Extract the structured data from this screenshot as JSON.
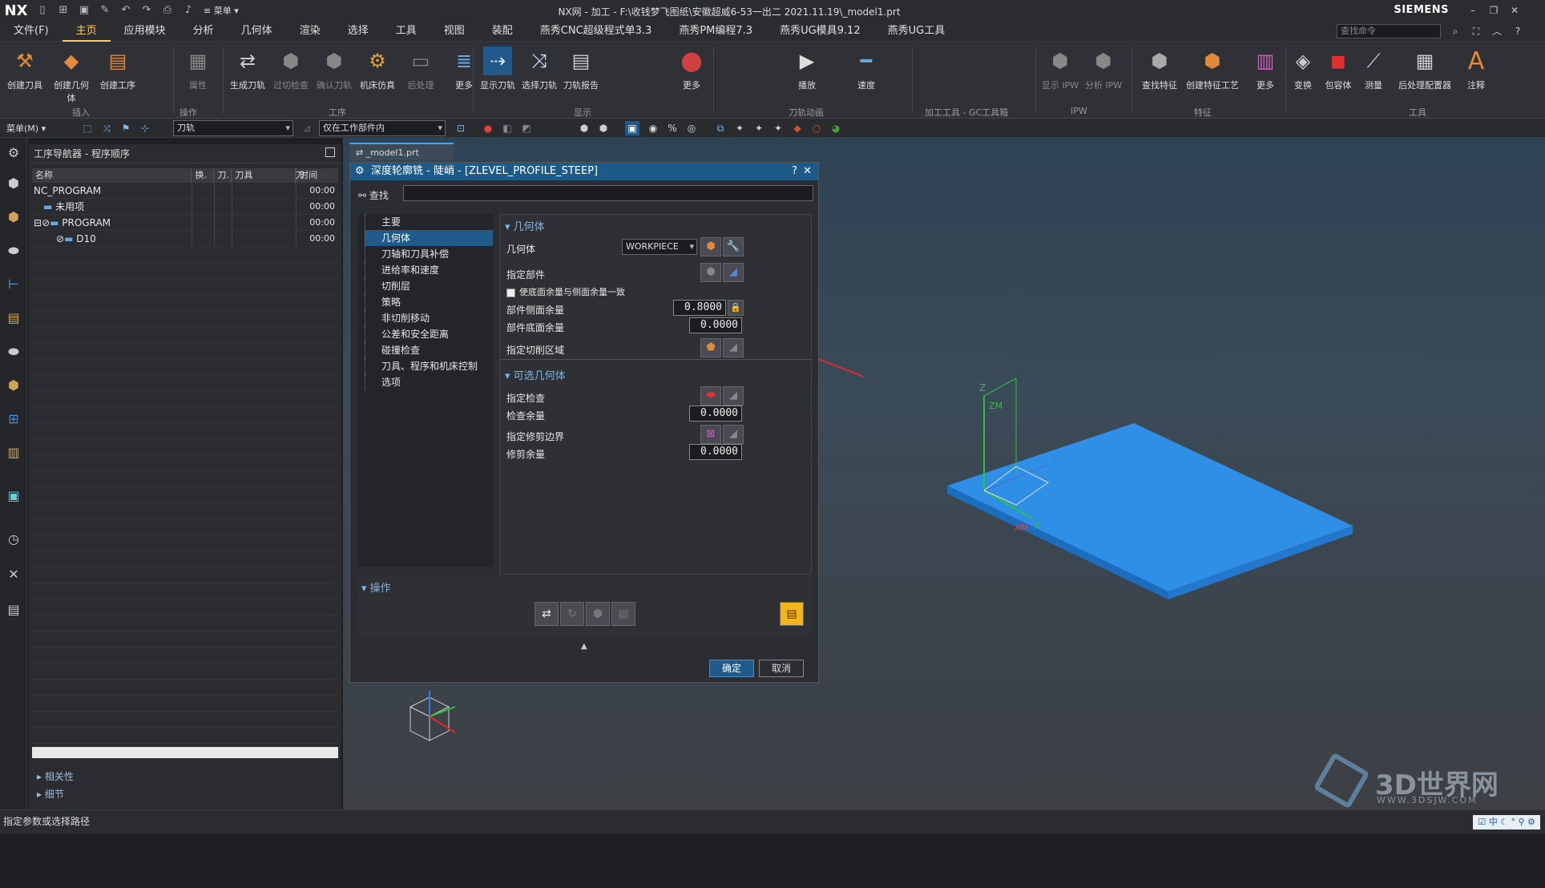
{
  "app": {
    "logo": "NX",
    "title": "NX网 - 加工 - F:\\收钱梦飞图纸\\安徽超威6-53一出二 2021.11.19\\_model1.prt",
    "brand": "SIEMENS",
    "quick_menu": "≡ 菜单 ▾"
  },
  "menubar": {
    "items": [
      "文件(F)",
      "主页",
      "应用模块",
      "分析",
      "几何体",
      "渲染",
      "选择",
      "工具",
      "视图",
      "装配",
      "燕秀CNC超级程式单3.3",
      "燕秀PM编程7.3",
      "燕秀UG模具9.12",
      "燕秀UG工具"
    ],
    "active_index": 1,
    "search_placeholder": "查找命令"
  },
  "ribbon": {
    "buttons": [
      {
        "label": "创建刀具",
        "icon": "create-tool-icon"
      },
      {
        "label": "创建几何体",
        "icon": "create-geometry-icon"
      },
      {
        "label": "创建工序",
        "icon": "create-operation-icon"
      },
      {
        "label": "属性",
        "icon": "properties-icon"
      },
      {
        "label": "生成刀轨",
        "icon": "generate-path-icon"
      },
      {
        "label": "过切检查",
        "icon": "gouge-check-icon"
      },
      {
        "label": "确认刀轨",
        "icon": "verify-path-icon"
      },
      {
        "label": "机床仿真",
        "icon": "machine-sim-icon"
      },
      {
        "label": "后处理",
        "icon": "postprocess-icon"
      },
      {
        "label": "更多",
        "icon": "more-icon"
      },
      {
        "label": "显示刀轨",
        "icon": "show-path-icon"
      },
      {
        "label": "选择刀轨",
        "icon": "select-path-icon"
      },
      {
        "label": "刀轨报告",
        "icon": "path-report-icon"
      },
      {
        "label": "更多",
        "icon": "more-icon"
      },
      {
        "label": "播放",
        "icon": "play-icon"
      },
      {
        "label": "速度",
        "icon": "speed-icon"
      },
      {
        "label": "显示 IPW",
        "icon": "show-ipw-icon"
      },
      {
        "label": "分析 IPW",
        "icon": "analyze-ipw-icon"
      },
      {
        "label": "查找特征",
        "icon": "find-feature-icon"
      },
      {
        "label": "创建特征工艺",
        "icon": "feature-process-icon"
      },
      {
        "label": "更多",
        "icon": "more-icon"
      },
      {
        "label": "变换",
        "icon": "transform-icon"
      },
      {
        "label": "包容体",
        "icon": "bounding-body-icon"
      },
      {
        "label": "测量",
        "icon": "measure-icon"
      },
      {
        "label": "后处理配置器",
        "icon": "post-config-icon"
      },
      {
        "label": "注释",
        "icon": "annotation-icon"
      }
    ],
    "groups": [
      "插入",
      "操作",
      "工序",
      "显示",
      "刀轨动画",
      "加工工具 - GC工具箱",
      "IPW",
      "特征",
      "工具"
    ]
  },
  "selbar": {
    "menu": "菜单(M) ▾",
    "filter1": "刀轨",
    "filter2": "仅在工作部件内"
  },
  "navigator": {
    "title": "工序导航器 - 程序顺序",
    "columns": [
      "名称",
      "换.",
      "刀.",
      "刀具",
      "刀",
      "时间"
    ],
    "rows": [
      {
        "name": "NC_PROGRAM",
        "time": "00:00",
        "indent": 0
      },
      {
        "name": "未用项",
        "time": "00:00",
        "indent": 1
      },
      {
        "name": "PROGRAM",
        "time": "00:00",
        "indent": 1
      },
      {
        "name": "D10",
        "time": "00:00",
        "indent": 2
      }
    ],
    "sections": [
      "相关性",
      "细节"
    ]
  },
  "viewport_tab": "_model1.prt",
  "dialog": {
    "title": "深度轮廓铣 - 陡峭 - [ZLEVEL_PROFILE_STEEP]",
    "find_label": "查找",
    "tree": [
      "主要",
      "几何体",
      "刀轴和刀具补偿",
      "进给率和速度",
      "切削层",
      "策略",
      "非切削移动",
      "公差和安全距离",
      "碰撞检查",
      "刀具、程序和机床控制",
      "选项"
    ],
    "tree_selected": 1,
    "geometry_section": "几何体",
    "geometry_label": "几何体",
    "geometry_value": "WORKPIECE",
    "specify_part": "指定部件",
    "same_floor_stock": "使底面余量与侧面余量一致",
    "side_stock_label": "部件侧面余量",
    "side_stock_value": "0.8000",
    "floor_stock_label": "部件底面余量",
    "floor_stock_value": "0.0000",
    "cut_area_label": "指定切削区域",
    "optional_section": "可选几何体",
    "check_label": "指定检查",
    "check_stock_label": "检查余量",
    "check_stock_value": "0.0000",
    "trim_label": "指定修剪边界",
    "trim_stock_label": "修剪余量",
    "trim_stock_value": "0.0000",
    "ops_section": "操作",
    "ok": "确定",
    "cancel": "取消"
  },
  "axis_labels": {
    "z": "Z",
    "zm": "ZM",
    "y": "Y",
    "xm": "XM",
    "x": "X"
  },
  "watermark": {
    "name": "3D世界网",
    "url": "WWW.3DSJW.COM"
  },
  "status": "指定参数或选择路径",
  "colors": {
    "accent": "#1f5a8a",
    "part": "#2f8fe6",
    "arrow": "#e02a2a"
  }
}
